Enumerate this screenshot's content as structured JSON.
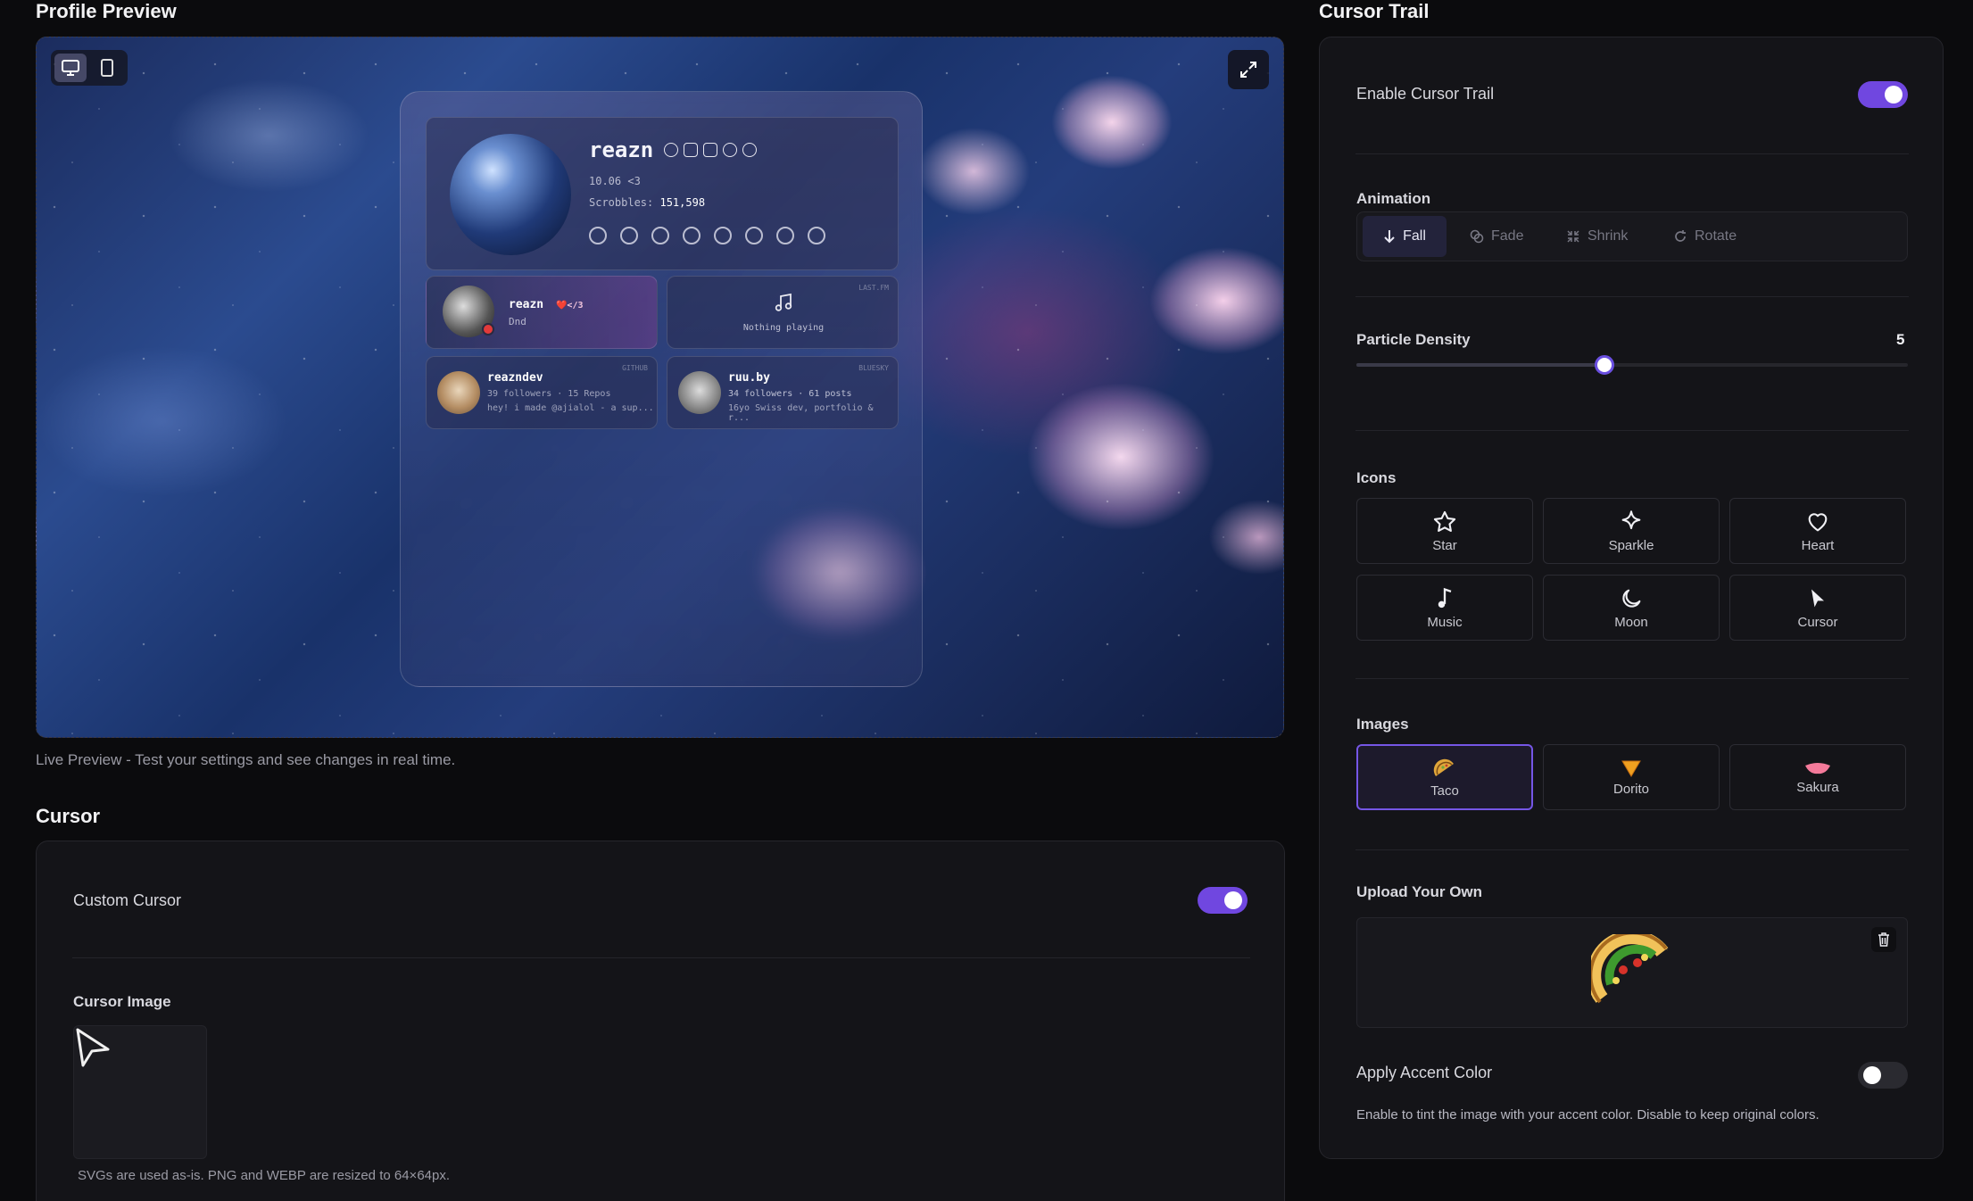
{
  "left": {
    "preview_title": "Profile Preview",
    "preview_caption": "Live Preview - Test your settings and see changes in real time.",
    "profile": {
      "username": "reazn",
      "tagline": "10.06 <3",
      "scrobbles_label": "Scrobbles:",
      "scrobbles_value": "151,598",
      "discord": {
        "name": "reazn",
        "tag": "❤️</3",
        "status": "Dnd"
      },
      "music": {
        "source": "LAST.FM",
        "text": "Nothing playing"
      },
      "github": {
        "source": "GITHUB",
        "name": "reazndev",
        "stats": "39 followers · 15 Repos",
        "bio": "hey! i made @ajialol - a sup..."
      },
      "bluesky": {
        "source": "BLUESKY",
        "name": "ruu.by",
        "stats": "34 followers · 61 posts",
        "bio": "16yo Swiss dev, portfolio & r..."
      }
    },
    "cursor_title": "Cursor",
    "custom_cursor_label": "Custom Cursor",
    "custom_cursor_on": true,
    "cursor_image_label": "Cursor Image",
    "cursor_note": "SVGs are used as-is. PNG and WEBP are resized to 64×64px."
  },
  "right": {
    "title": "Cursor Trail",
    "enable_label": "Enable Cursor Trail",
    "enable_on": true,
    "animation_label": "Animation",
    "animations": [
      {
        "label": "Fall",
        "icon": "arrow-down-icon",
        "active": true
      },
      {
        "label": "Fade",
        "icon": "fade-icon",
        "active": false
      },
      {
        "label": "Shrink",
        "icon": "shrink-icon",
        "active": false
      },
      {
        "label": "Rotate",
        "icon": "rotate-icon",
        "active": false
      }
    ],
    "density_label": "Particle Density",
    "density_value": "5",
    "density_fraction": 0.45,
    "icons_label": "Icons",
    "icons": [
      {
        "label": "Star",
        "icon": "star-icon"
      },
      {
        "label": "Sparkle",
        "icon": "sparkle-icon"
      },
      {
        "label": "Heart",
        "icon": "heart-icon"
      },
      {
        "label": "Music",
        "icon": "music-icon"
      },
      {
        "label": "Moon",
        "icon": "moon-icon"
      },
      {
        "label": "Cursor",
        "icon": "cursor-icon"
      }
    ],
    "images_label": "Images",
    "images": [
      {
        "label": "Taco",
        "icon": "taco-icon",
        "selected": true
      },
      {
        "label": "Dorito",
        "icon": "dorito-icon",
        "selected": false
      },
      {
        "label": "Sakura",
        "icon": "sakura-icon",
        "selected": false
      }
    ],
    "upload_label": "Upload Your Own",
    "accent_label": "Apply Accent Color",
    "accent_on": false,
    "accent_note": "Enable to tint the image with your accent color. Disable to keep original colors."
  },
  "colors": {
    "accent": "#7047e0",
    "panel": "#141418",
    "background": "#0b0b0d"
  }
}
